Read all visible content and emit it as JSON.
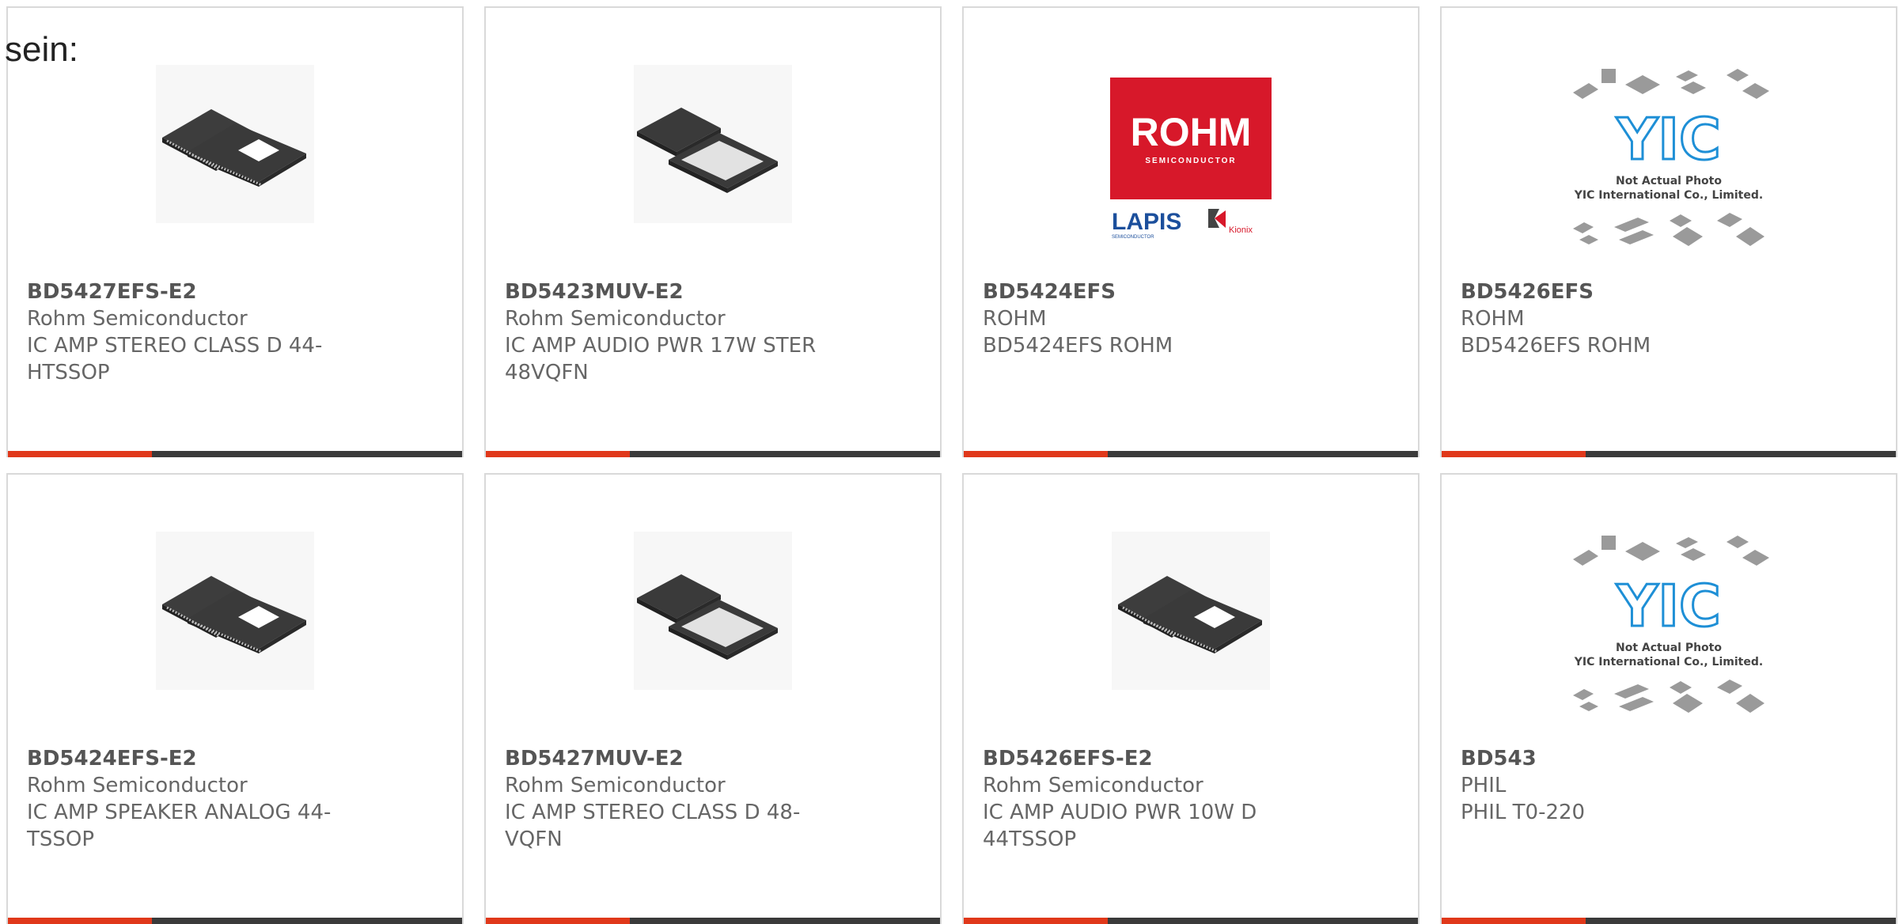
{
  "page": {
    "top_label": "sein:"
  },
  "colors": {
    "accent": "#e0381a",
    "bar": "#3a3a3a",
    "rohm_red": "#d7182a",
    "lapis_blue": "#1c4f9c",
    "yic_blue": "#1e8fd6"
  },
  "products": [
    {
      "part": "BD5427EFS-E2",
      "manufacturer": "Rohm Semiconductor",
      "description": "IC AMP STEREO CLASS D 44-HTSSOP",
      "image": "htssop-package-image"
    },
    {
      "part": "BD5423MUV-E2",
      "manufacturer": "Rohm Semiconductor",
      "description": "IC AMP AUDIO PWR 17W STER 48VQFN",
      "image": "vqfn-package-image"
    },
    {
      "part": "BD5424EFS",
      "manufacturer": "ROHM",
      "description": "BD5424EFS ROHM",
      "image": "rohm-logo-image",
      "logo": {
        "rohm": "ROHM",
        "rohm_sub": "SEMICONDUCTOR",
        "lapis": "LAPIS",
        "lapis_sub": "SEMICONDUCTOR",
        "kionix": "Kionix"
      }
    },
    {
      "part": "BD5426EFS",
      "manufacturer": "ROHM",
      "description": "BD5426EFS ROHM",
      "image": "yic-placeholder-image",
      "placeholder": {
        "logo": "YIC",
        "line1": "Not Actual Photo",
        "line2": "YIC International Co., Limited."
      }
    },
    {
      "part": "BD5424EFS-E2",
      "manufacturer": "Rohm Semiconductor",
      "description": "IC AMP SPEAKER ANALOG 44-TSSOP",
      "image": "htssop-package-image"
    },
    {
      "part": "BD5427MUV-E2",
      "manufacturer": "Rohm Semiconductor",
      "description": "IC AMP STEREO CLASS D 48-VQFN",
      "image": "vqfn-package-image"
    },
    {
      "part": "BD5426EFS-E2",
      "manufacturer": "Rohm Semiconductor",
      "description": "IC AMP AUDIO PWR 10W D 44TSSOP",
      "image": "htssop-package-image"
    },
    {
      "part": "BD543",
      "manufacturer": "PHIL",
      "description": "PHIL T0-220",
      "image": "yic-placeholder-image",
      "placeholder": {
        "logo": "YIC",
        "line1": "Not Actual Photo",
        "line2": "YIC International Co., Limited."
      }
    }
  ]
}
